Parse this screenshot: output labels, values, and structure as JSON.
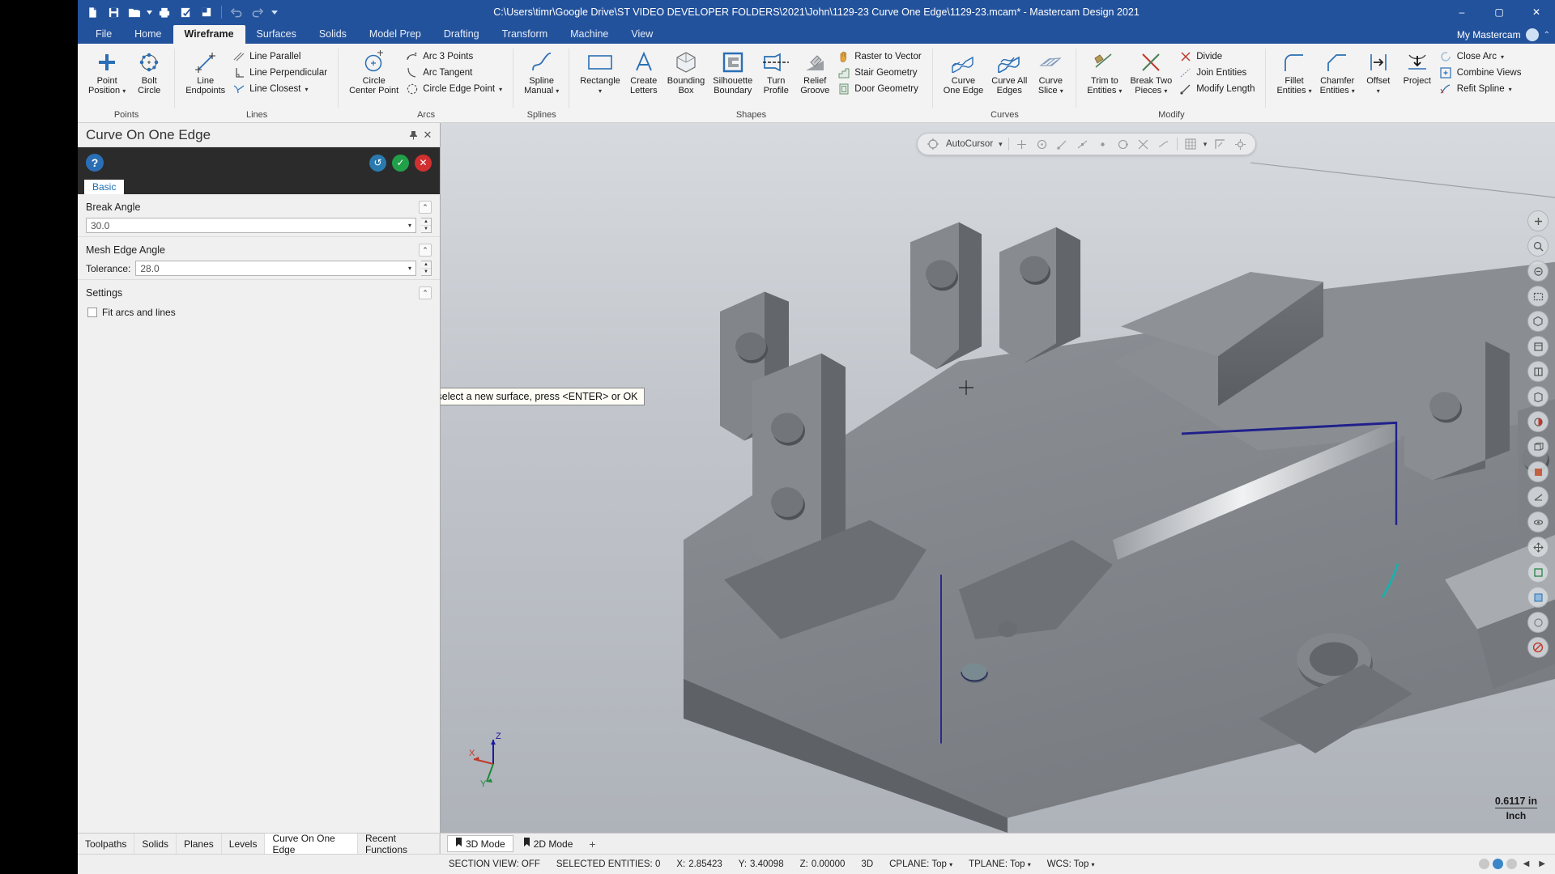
{
  "window": {
    "title": "C:\\Users\\timr\\Google Drive\\ST VIDEO DEVELOPER FOLDERS\\2021\\John\\1129-23 Curve One Edge\\1129-23.mcam* - Mastercam Design 2021",
    "minimize": "–",
    "maximize": "▢",
    "close": "✕"
  },
  "quick_access": [
    {
      "name": "new-file-icon",
      "tip": "New"
    },
    {
      "name": "save-icon",
      "tip": "Save"
    },
    {
      "name": "open-folder-icon",
      "tip": "Open"
    },
    {
      "name": "open-dropdown-caret",
      "tip": "▾"
    },
    {
      "name": "print-icon",
      "tip": "Print"
    },
    {
      "name": "print-preview-icon",
      "tip": "Print Preview"
    },
    {
      "name": "zoom-window-icon",
      "tip": "Zoom"
    },
    {
      "name": "undo-icon",
      "tip": "Undo"
    },
    {
      "name": "redo-icon",
      "tip": "Redo"
    },
    {
      "name": "customize-qat-caret",
      "tip": "▾"
    }
  ],
  "tabs": [
    {
      "label": "File",
      "active": false
    },
    {
      "label": "Home",
      "active": false
    },
    {
      "label": "Wireframe",
      "active": true
    },
    {
      "label": "Surfaces",
      "active": false
    },
    {
      "label": "Solids",
      "active": false
    },
    {
      "label": "Model Prep",
      "active": false
    },
    {
      "label": "Drafting",
      "active": false
    },
    {
      "label": "Transform",
      "active": false
    },
    {
      "label": "Machine",
      "active": false
    },
    {
      "label": "View",
      "active": false
    }
  ],
  "tab_right": {
    "my_mastercam": "My Mastercam",
    "collapse_caret": "⌃"
  },
  "ribbon": {
    "groups": [
      {
        "label": "Points",
        "big": [
          {
            "name": "point-position-button",
            "label": "Point\nPosition",
            "icon": "plus-cross-icon",
            "caret": true
          },
          {
            "name": "bolt-circle-button",
            "label": "Bolt\nCircle",
            "icon": "bolt-circle-icon",
            "caret": false
          }
        ],
        "small": []
      },
      {
        "label": "Lines",
        "big": [
          {
            "name": "line-endpoints-button",
            "label": "Line\nEndpoints",
            "icon": "line-endpoints-icon",
            "caret": false
          }
        ],
        "small": [
          {
            "name": "line-parallel-button",
            "label": "Line Parallel",
            "icon": "line-parallel-icon",
            "caret": false
          },
          {
            "name": "line-perpendicular-button",
            "label": "Line Perpendicular",
            "icon": "line-perpendicular-icon",
            "caret": false
          },
          {
            "name": "line-closest-button",
            "label": "Line Closest",
            "icon": "line-closest-icon",
            "caret": true
          }
        ]
      },
      {
        "label": "Arcs",
        "big": [
          {
            "name": "circle-center-point-button",
            "label": "Circle\nCenter Point",
            "icon": "circle-center-icon",
            "caret": false
          }
        ],
        "small": [
          {
            "name": "arc-3-points-button",
            "label": "Arc 3 Points",
            "icon": "arc-3-points-icon",
            "caret": false
          },
          {
            "name": "arc-tangent-button",
            "label": "Arc Tangent",
            "icon": "arc-tangent-icon",
            "caret": false
          },
          {
            "name": "circle-edge-point-button",
            "label": "Circle Edge Point",
            "icon": "circle-edge-point-icon",
            "caret": true
          }
        ]
      },
      {
        "label": "Splines",
        "big": [
          {
            "name": "spline-manual-button",
            "label": "Spline\nManual",
            "icon": "spline-icon",
            "caret": true
          }
        ],
        "small": []
      },
      {
        "label": "Shapes",
        "big": [
          {
            "name": "rectangle-button",
            "label": "Rectangle",
            "icon": "rectangle-icon",
            "caret": true
          },
          {
            "name": "create-letters-button",
            "label": "Create\nLetters",
            "icon": "letter-a-icon",
            "caret": false
          },
          {
            "name": "bounding-box-button",
            "label": "Bounding\nBox",
            "icon": "bounding-box-icon",
            "caret": false
          },
          {
            "name": "silhouette-boundary-button",
            "label": "Silhouette\nBoundary",
            "icon": "silhouette-boundary-icon",
            "caret": false
          },
          {
            "name": "turn-profile-button",
            "label": "Turn\nProfile",
            "icon": "turn-profile-icon",
            "caret": false
          },
          {
            "name": "relief-groove-button",
            "label": "Relief\nGroove",
            "icon": "relief-groove-icon",
            "caret": false
          }
        ],
        "small": [
          {
            "name": "raster-to-vector-button",
            "label": "Raster to Vector",
            "icon": "hand-icon",
            "caret": false
          },
          {
            "name": "stair-geometry-button",
            "label": "Stair Geometry",
            "icon": "stair-icon",
            "caret": false
          },
          {
            "name": "door-geometry-button",
            "label": "Door Geometry",
            "icon": "door-icon",
            "caret": false
          }
        ]
      },
      {
        "label": "Curves",
        "big": [
          {
            "name": "curve-one-edge-button",
            "label": "Curve\nOne Edge",
            "icon": "curve-one-edge-icon",
            "caret": false
          },
          {
            "name": "curve-all-edges-button",
            "label": "Curve All\nEdges",
            "icon": "curve-all-edges-icon",
            "caret": false
          },
          {
            "name": "curve-slice-button",
            "label": "Curve\nSlice",
            "icon": "curve-slice-icon",
            "caret": true
          }
        ],
        "small": []
      },
      {
        "label": "Modify",
        "big": [
          {
            "name": "trim-to-entities-button",
            "label": "Trim to\nEntities",
            "icon": "trim-icon",
            "caret": true
          },
          {
            "name": "break-two-pieces-button",
            "label": "Break Two\nPieces",
            "icon": "break-icon",
            "caret": true
          }
        ],
        "small": [
          {
            "name": "divide-button",
            "label": "Divide",
            "icon": "divide-icon",
            "caret": false
          },
          {
            "name": "join-entities-button",
            "label": "Join Entities",
            "icon": "join-icon",
            "caret": false
          },
          {
            "name": "modify-length-button",
            "label": "Modify Length",
            "icon": "modify-length-icon",
            "caret": false
          }
        ]
      },
      {
        "label": "",
        "big": [
          {
            "name": "fillet-entities-button",
            "label": "Fillet\nEntities",
            "icon": "fillet-icon",
            "caret": true
          },
          {
            "name": "chamfer-entities-button",
            "label": "Chamfer\nEntities",
            "icon": "chamfer-icon",
            "caret": true
          },
          {
            "name": "offset-button",
            "label": "Offset",
            "icon": "offset-icon",
            "caret": true
          },
          {
            "name": "project-button",
            "label": "Project",
            "icon": "project-icon",
            "caret": false
          }
        ],
        "small": [
          {
            "name": "close-arc-button",
            "label": "Close Arc",
            "icon": "close-arc-icon",
            "caret": true
          },
          {
            "name": "combine-views-button",
            "label": "Combine Views",
            "icon": "combine-views-icon",
            "caret": false
          },
          {
            "name": "refit-spline-button",
            "label": "Refit Spline",
            "icon": "refit-spline-icon",
            "caret": true
          }
        ]
      }
    ]
  },
  "left_panel": {
    "title": "Curve On One Edge",
    "pin": "📌",
    "close": "✕",
    "help": "?",
    "actions": [
      {
        "name": "reselect-button",
        "glyph": "↺"
      },
      {
        "name": "ok-button",
        "glyph": "✓"
      },
      {
        "name": "cancel-button",
        "glyph": "✕"
      }
    ],
    "tab": "Basic",
    "sections": [
      {
        "heading": "Break Angle",
        "collapse": "⌃",
        "field_label": "",
        "value": "30.0",
        "has_dropdown": true,
        "has_spinner": true
      },
      {
        "heading": "Mesh Edge Angle",
        "collapse": "⌃",
        "field_label": "Tolerance:",
        "value": "28.0",
        "has_dropdown": true,
        "has_spinner": true
      }
    ],
    "settings": {
      "heading": "Settings",
      "collapse": "⌃",
      "checkbox_label": "Fit arcs and lines",
      "checked": false
    }
  },
  "viewport": {
    "autocursor": {
      "label": "AutoCursor",
      "caret": "▾",
      "icons": [
        "origin-icon",
        "arc-center-icon",
        "endpoint-icon",
        "midpoint-icon",
        "point-icon",
        "quadrant-icon",
        "intersection-icon",
        "nearest-icon",
        "grid-icon",
        "relative-icon",
        "settings-icon"
      ]
    },
    "tooltip": "Set options, select a new surface, press <ENTER> or OK",
    "scale_value": "0.6117 in",
    "scale_unit": "Inch",
    "axis_labels": {
      "x": "X",
      "y": "Y",
      "z": "Z"
    },
    "right_tools": [
      "zoom-in-icon",
      "fit-icon",
      "unzoom-icon",
      "zoom-window-icon",
      "isometric-icon",
      "top-view-icon",
      "front-view-icon",
      "right-view-icon",
      "shading-icon",
      "wireframe-icon",
      "translucency-icon",
      "section-view-icon",
      "dynamic-rotate-icon",
      "pan-icon",
      "blank-icon",
      "unblank-icon",
      "clear-colors-icon",
      "no-entry-icon"
    ]
  },
  "bottom_tabs": {
    "left": [
      {
        "label": "Toolpaths",
        "active": false
      },
      {
        "label": "Solids",
        "active": false
      },
      {
        "label": "Planes",
        "active": false
      },
      {
        "label": "Levels",
        "active": false
      },
      {
        "label": "Curve On One Edge",
        "active": true
      },
      {
        "label": "Recent Functions",
        "active": false
      }
    ],
    "right": [
      {
        "label": "3D Mode",
        "active": true,
        "icon": "flag-icon"
      },
      {
        "label": "2D Mode",
        "active": false,
        "icon": "flag-icon"
      }
    ],
    "plus": "+"
  },
  "status_bar": {
    "section_view": "SECTION VIEW: OFF",
    "selected_entities": "SELECTED ENTITIES: 0",
    "x_label": "X:",
    "x_value": "2.85423",
    "y_label": "Y:",
    "y_value": "3.40098",
    "z_label": "Z:",
    "z_value": "0.00000",
    "mode": "3D",
    "cplane": "CPLANE: Top",
    "tplane": "TPLANE: Top",
    "wcs": "WCS: Top",
    "caret": "▾",
    "nav_prev": "◀",
    "nav_next": "▶"
  },
  "colors": {
    "title_blue": "#23529c",
    "ribbon_bg": "#f3f3f3",
    "panel_dark": "#2b2b2b",
    "accent_blue": "#2a6fb5",
    "ok_green": "#21a04a",
    "cancel_red": "#d03030",
    "highlight_line": "#2a2a8c"
  }
}
